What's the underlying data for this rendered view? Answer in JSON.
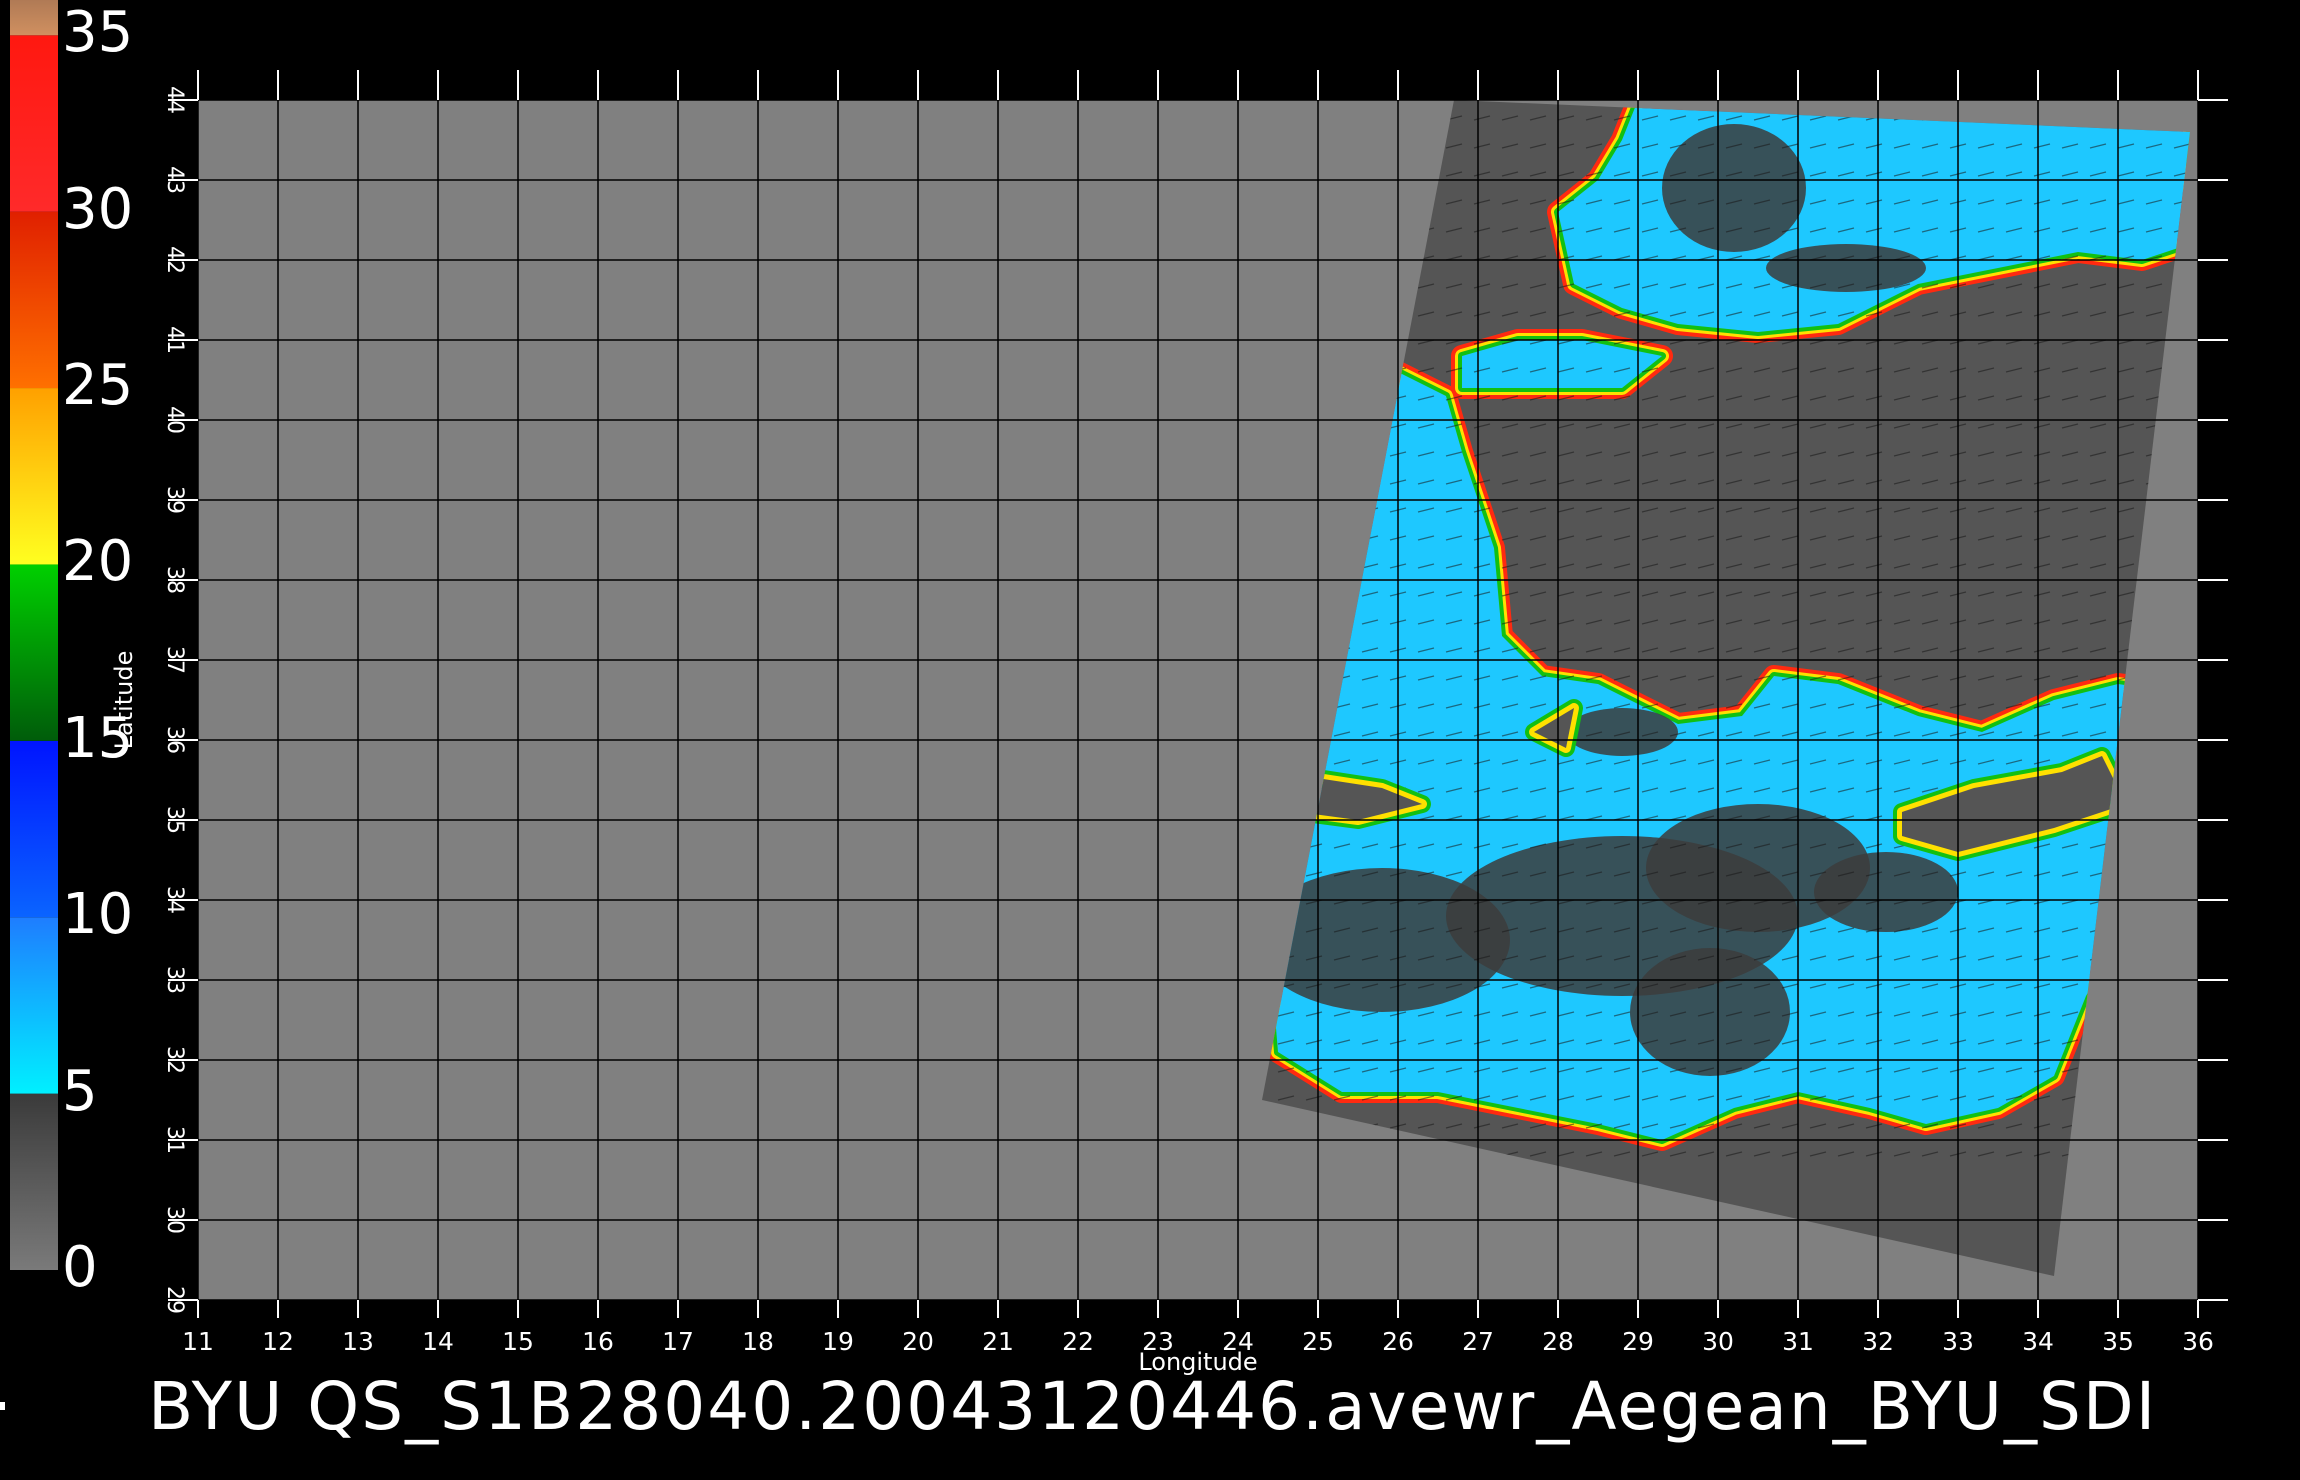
{
  "caption": "BYU  QS_S1B28040.20043120446.avewr_Aegean_BYU_SDI",
  "colorbar": {
    "ticks": [
      "0",
      "5",
      "10",
      "15",
      "20",
      "25",
      "30",
      "35"
    ],
    "stops": [
      {
        "from": 0,
        "to": 5,
        "top": "#3a3a3a",
        "bottom": "#7a7a7a"
      },
      {
        "from": 5,
        "to": 10,
        "top": "#1e7dff",
        "bottom": "#00f0ff"
      },
      {
        "from": 10,
        "to": 15,
        "top": "#0014ff",
        "bottom": "#0a64ff"
      },
      {
        "from": 15,
        "to": 20,
        "top": "#00d000",
        "bottom": "#005c0a"
      },
      {
        "from": 20,
        "to": 25,
        "top": "#ffa000",
        "bottom": "#ffff20"
      },
      {
        "from": 25,
        "to": 30,
        "top": "#e02000",
        "bottom": "#ff7000"
      },
      {
        "from": 30,
        "to": 35,
        "top": "#ff1810",
        "bottom": "#ff2a2a"
      },
      {
        "from": 35,
        "to": 36,
        "top": "#b07a55",
        "bottom": "#d09060"
      }
    ]
  },
  "map": {
    "lon_range": [
      11,
      36
    ],
    "lat_range": [
      29,
      44
    ],
    "lon_ticks": [
      "11",
      "12",
      "13",
      "14",
      "15",
      "16",
      "17",
      "18",
      "19",
      "20",
      "21",
      "22",
      "23",
      "24",
      "25",
      "26",
      "27",
      "28",
      "29",
      "30",
      "31",
      "32",
      "33",
      "34",
      "35",
      "36"
    ],
    "lat_ticks": [
      "29",
      "30",
      "31",
      "32",
      "33",
      "34",
      "35",
      "36",
      "37",
      "38",
      "39",
      "40",
      "41",
      "42",
      "43",
      "44"
    ],
    "xlabel": "Longitude",
    "ylabel": "Latitude",
    "grid": true,
    "background_color": "#808080",
    "swath_color": "#555555",
    "land_color": "#555555",
    "sea_color": "#1ec8ff",
    "swath_corners_lonlat": [
      [
        26.7,
        44.0
      ],
      [
        35.9,
        43.6
      ],
      [
        34.2,
        29.3
      ],
      [
        24.3,
        31.5
      ]
    ],
    "water_bodies": [
      {
        "name": "eastern-mediterranean",
        "coast": [
          [
            24.5,
            32.1
          ],
          [
            25.3,
            31.6
          ],
          [
            26.5,
            31.6
          ],
          [
            27.5,
            31.4
          ],
          [
            28.5,
            31.2
          ],
          [
            29.3,
            31.0
          ],
          [
            30.2,
            31.4
          ],
          [
            31.0,
            31.6
          ],
          [
            31.9,
            31.4
          ],
          [
            32.6,
            31.2
          ],
          [
            33.5,
            31.4
          ],
          [
            34.2,
            31.8
          ],
          [
            34.6,
            32.8
          ],
          [
            35.0,
            33.5
          ],
          [
            35.3,
            34.3
          ],
          [
            35.6,
            35.2
          ],
          [
            35.9,
            35.9
          ],
          [
            35.7,
            36.6
          ],
          [
            35.0,
            36.7
          ],
          [
            34.2,
            36.5
          ],
          [
            33.3,
            36.1
          ],
          [
            32.5,
            36.3
          ],
          [
            31.5,
            36.7
          ],
          [
            30.7,
            36.8
          ],
          [
            30.3,
            36.3
          ],
          [
            29.5,
            36.2
          ],
          [
            28.5,
            36.7
          ],
          [
            27.8,
            36.8
          ],
          [
            27.3,
            37.3
          ],
          [
            27.2,
            38.4
          ],
          [
            27.0,
            39.0
          ],
          [
            26.8,
            39.6
          ],
          [
            26.6,
            40.3
          ],
          [
            26.0,
            40.6
          ],
          [
            25.8,
            40.0
          ],
          [
            25.6,
            38.8
          ],
          [
            25.1,
            38.3
          ],
          [
            24.7,
            37.0
          ],
          [
            24.4,
            35.7
          ],
          [
            24.3,
            34.5
          ]
        ]
      },
      {
        "name": "black-sea",
        "coast": [
          [
            28.0,
            42.6
          ],
          [
            28.5,
            43.0
          ],
          [
            28.8,
            43.5
          ],
          [
            29.0,
            44.0
          ],
          [
            35.9,
            44.0
          ],
          [
            35.9,
            42.2
          ],
          [
            35.3,
            42.0
          ],
          [
            34.5,
            42.1
          ],
          [
            33.5,
            41.9
          ],
          [
            32.5,
            41.7
          ],
          [
            31.5,
            41.2
          ],
          [
            30.5,
            41.1
          ],
          [
            29.5,
            41.2
          ],
          [
            28.8,
            41.4
          ],
          [
            28.2,
            41.7
          ]
        ]
      },
      {
        "name": "marmara-sea",
        "coast": [
          [
            26.8,
            40.8
          ],
          [
            27.5,
            41.0
          ],
          [
            28.3,
            41.0
          ],
          [
            29.3,
            40.8
          ],
          [
            28.8,
            40.4
          ],
          [
            27.6,
            40.4
          ],
          [
            26.8,
            40.4
          ]
        ]
      }
    ],
    "land_masses": [
      {
        "name": "cyprus",
        "coast": [
          [
            32.3,
            35.1
          ],
          [
            33.2,
            35.4
          ],
          [
            34.3,
            35.6
          ],
          [
            34.8,
            35.8
          ],
          [
            35.1,
            35.2
          ],
          [
            34.2,
            34.9
          ],
          [
            33.0,
            34.6
          ],
          [
            32.3,
            34.8
          ]
        ]
      },
      {
        "name": "crete",
        "coast": [
          [
            23.6,
            35.5
          ],
          [
            24.5,
            35.6
          ],
          [
            25.8,
            35.4
          ],
          [
            26.3,
            35.2
          ],
          [
            25.5,
            35.0
          ],
          [
            24.0,
            35.2
          ]
        ]
      },
      {
        "name": "rhodes",
        "coast": [
          [
            27.7,
            36.1
          ],
          [
            28.2,
            36.4
          ],
          [
            28.1,
            35.9
          ]
        ]
      }
    ],
    "calm_patches": [
      {
        "lon": 25.8,
        "lat": 33.5,
        "rx": 1.6,
        "ry": 0.9
      },
      {
        "lon": 28.8,
        "lat": 33.8,
        "rx": 2.2,
        "ry": 1.0
      },
      {
        "lon": 30.5,
        "lat": 34.4,
        "rx": 1.4,
        "ry": 0.8
      },
      {
        "lon": 29.9,
        "lat": 32.6,
        "rx": 1.0,
        "ry": 0.8
      },
      {
        "lon": 32.1,
        "lat": 34.1,
        "rx": 0.9,
        "ry": 0.5
      },
      {
        "lon": 30.2,
        "lat": 42.9,
        "rx": 0.9,
        "ry": 0.8
      },
      {
        "lon": 31.6,
        "lat": 41.9,
        "rx": 1.0,
        "ry": 0.3
      },
      {
        "lon": 28.8,
        "lat": 36.1,
        "rx": 0.7,
        "ry": 0.3
      }
    ]
  }
}
